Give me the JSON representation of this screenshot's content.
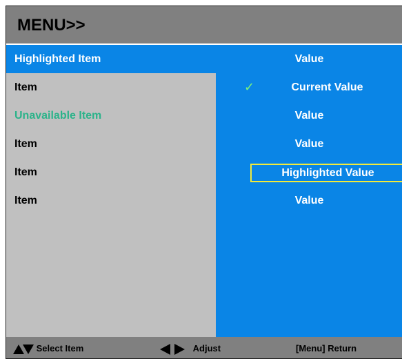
{
  "menu": {
    "title": "MENU>>",
    "rows": [
      {
        "label": "Highlighted Item",
        "value": "Value",
        "state": "highlighted"
      },
      {
        "label": "Item",
        "value": "Current Value",
        "state": "current"
      },
      {
        "label": "Unavailable Item",
        "value": "Value",
        "state": "unavailable"
      },
      {
        "label": "Item",
        "value": "Value",
        "state": "normal"
      },
      {
        "label": "Item",
        "value": "Highlighted Value",
        "state": "value-highlighted"
      },
      {
        "label": "Item",
        "value": "Value",
        "state": "normal"
      }
    ],
    "check_glyph": "✓"
  },
  "footer": {
    "select_label": "Select Item",
    "adjust_label": "Adjust",
    "return_label": "[Menu] Return"
  },
  "colors": {
    "title_bg": "#808080",
    "panel_left": "#c0c0c0",
    "panel_right": "#0a85e6",
    "unavailable_text": "#2bb38a",
    "check": "#7cf27c",
    "value_highlight_border": "#f2ea3a"
  },
  "icons": [
    "triangle-up-icon",
    "triangle-down-icon",
    "triangle-left-icon",
    "triangle-right-icon",
    "checkmark-icon"
  ]
}
